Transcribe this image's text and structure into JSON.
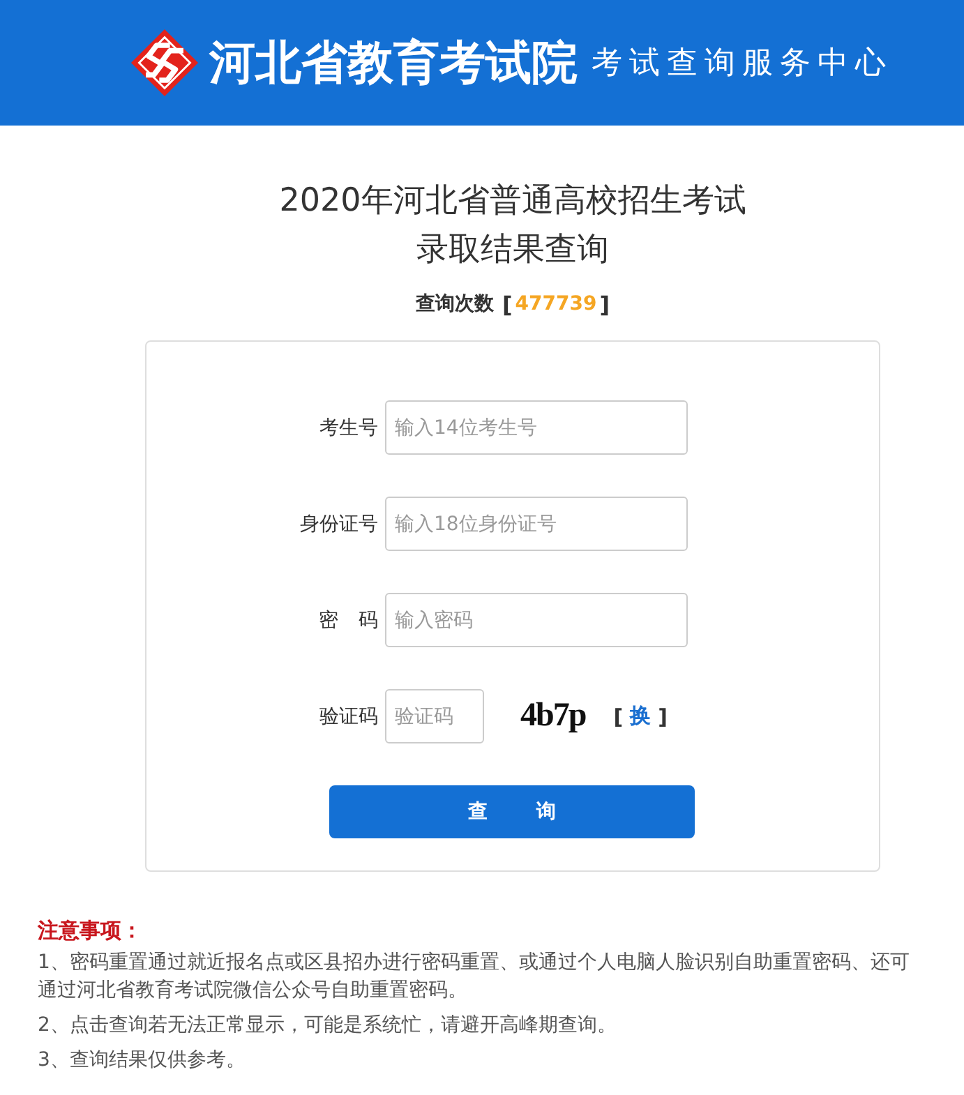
{
  "header": {
    "org_name": "河北省教育考试院",
    "subtitle": "考试查询服务中心"
  },
  "title_lines": [
    "2020年河北省普通高校招生考试",
    "录取结果查询"
  ],
  "query_count": {
    "label": "查询次数",
    "open": "[",
    "value": "477739",
    "close": "]"
  },
  "form": {
    "fields": [
      {
        "kind": "text",
        "label": "考生号",
        "placeholder": "输入14位考生号"
      },
      {
        "kind": "text",
        "label": "身份证号",
        "placeholder": "输入18位身份证号"
      },
      {
        "kind": "password",
        "label": "密 码",
        "placeholder": "输入密码"
      },
      {
        "kind": "captcha",
        "label": "验证码",
        "placeholder": "验证码",
        "captcha": "4b7p",
        "refresh": {
          "open": "[",
          "label": "换",
          "close": "]"
        }
      }
    ],
    "submit": "查 询"
  },
  "notice": {
    "heading": "注意事项：",
    "items": [
      [
        "1、密码重置通过就近报名点或区县招办进行密码重置、或通过个人电脑人脸识别自助重置密码、还可",
        "通过河北省教育考试院微信公众号自助重置密码。"
      ],
      [
        "2、点击查询若无法正常显示，可能是系统忙，请避开高峰期查询。"
      ],
      [
        "3、查询结果仅供参考。"
      ]
    ]
  }
}
